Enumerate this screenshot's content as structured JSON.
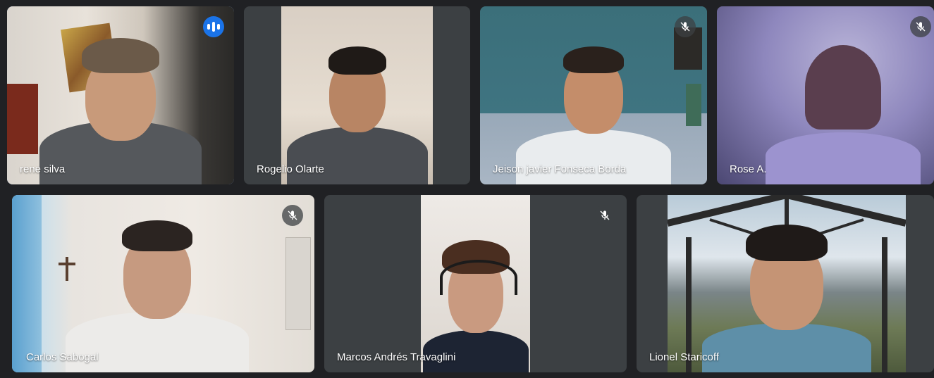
{
  "participants": [
    {
      "name": "rene silva",
      "muted": false,
      "speaking": true
    },
    {
      "name": "Rogelio Olarte",
      "muted": false,
      "speaking": false
    },
    {
      "name": "Jeison javier Fonseca Borda",
      "muted": true,
      "speaking": false
    },
    {
      "name": "Rose A.",
      "muted": true,
      "speaking": false
    },
    {
      "name": "Carlos Sabogal",
      "muted": true,
      "speaking": false
    },
    {
      "name": "Marcos Andrés Travaglini",
      "muted": true,
      "speaking": false
    },
    {
      "name": "Lionel Staricoff",
      "muted": false,
      "speaking": false
    }
  ],
  "icons": {
    "speaking": "audio-level-icon",
    "muted": "mic-off-icon"
  },
  "colors": {
    "background": "#202124",
    "tile": "#3c4043",
    "active_speaker_border": "#8ab4f8",
    "speaking_badge": "#1a73e8"
  }
}
